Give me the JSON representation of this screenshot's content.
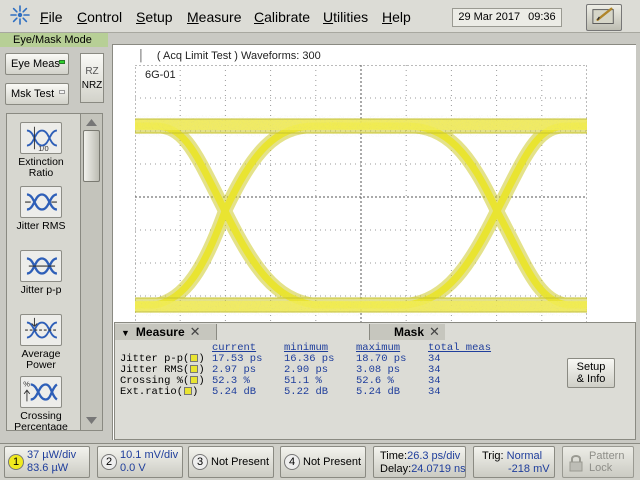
{
  "menu": {
    "items": [
      "File",
      "Control",
      "Setup",
      "Measure",
      "Calibrate",
      "Utilities",
      "Help"
    ],
    "date": "29 Mar 2017",
    "time": "09:36"
  },
  "icons": {
    "logo": "agilent-spark-icon",
    "helper": "stylus-pad-icon",
    "lock": "padlock-icon"
  },
  "left_panel": {
    "mode_title": "Eye/Mask Mode",
    "eye_meas_label": "Eye Meas",
    "mask_test_label": "Msk Test",
    "format_options": [
      "RZ",
      "NRZ"
    ],
    "tools": [
      {
        "label": "Extinction Ratio",
        "icon": "extinction-ratio-icon"
      },
      {
        "label": "Jitter RMS",
        "icon": "jitter-rms-icon"
      },
      {
        "label": "Jitter p-p",
        "icon": "jitter-pp-icon"
      },
      {
        "label": "Average Power",
        "icon": "average-power-icon"
      },
      {
        "label": "Crossing Percentage",
        "icon": "crossing-percentage-icon"
      }
    ]
  },
  "display": {
    "acq_status": "( Acq Limit Test )  Waveforms: 300",
    "channel_label": "6G-01",
    "trace_color": "#e9e431"
  },
  "measure_panel": {
    "tab_measure": "Measure",
    "tab_mask": "Mask",
    "headers": [
      "current",
      "minimum",
      "maximum",
      "total meas"
    ],
    "rows": [
      {
        "name": "Jitter p-p(",
        "current": "17.53 ps",
        "minimum": "16.36 ps",
        "maximum": "18.70 ps",
        "total": "34"
      },
      {
        "name": "Jitter RMS(",
        "current": "2.97 ps",
        "minimum": "2.90 ps",
        "maximum": "3.08 ps",
        "total": "34"
      },
      {
        "name": "Crossing %(",
        "current": "52.3 %",
        "minimum": "51.1 %",
        "maximum": "52.6 %",
        "total": "34"
      },
      {
        "name": "Ext.ratio(",
        "current": "5.24 dB",
        "minimum": "5.22 dB",
        "maximum": "5.24 dB",
        "total": "34"
      }
    ],
    "row_suffix": ")",
    "setup_info_line1": "Setup",
    "setup_info_line2": "& Info"
  },
  "bottom_bar": {
    "channels": [
      {
        "num": "1",
        "line1": "37 µW/div",
        "line2": "83.6 µW",
        "active": true
      },
      {
        "num": "2",
        "line1": "10.1 mV/div",
        "line2": "0.0 V",
        "active": false
      },
      {
        "num": "3",
        "line1": "Not Present",
        "line2": "",
        "active": false
      },
      {
        "num": "4",
        "line1": "Not Present",
        "line2": "",
        "active": false
      }
    ],
    "time_label": "Time:",
    "time_value": "26.3 ps/div",
    "delay_label": "Delay:",
    "delay_value": "24.0719 ns",
    "trig_label": "Trig:",
    "trig_mode": "Normal",
    "trig_level": "-218 mV",
    "lock_line1": "Pattern",
    "lock_line2": "Lock"
  }
}
